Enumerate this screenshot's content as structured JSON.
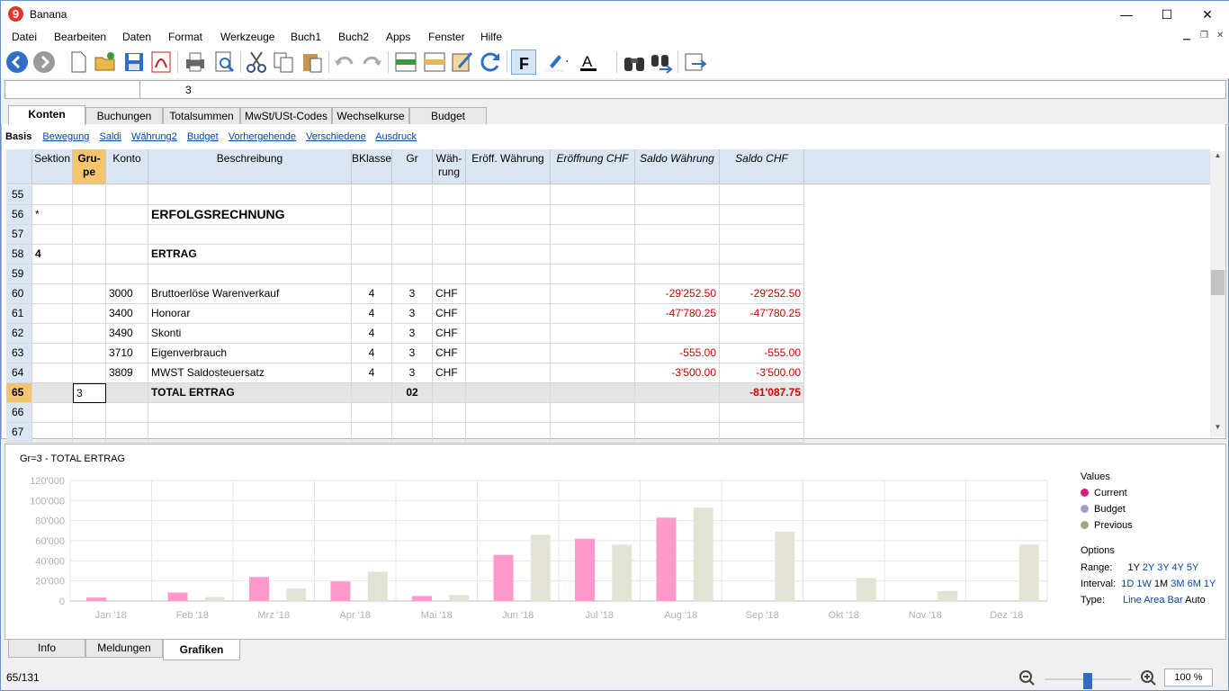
{
  "window": {
    "title": "Banana",
    "minimize": "—",
    "maximize": "☐",
    "close": "✕"
  },
  "menu": [
    "Datei",
    "Bearbeiten",
    "Daten",
    "Format",
    "Werkzeuge",
    "Buch1",
    "Buch2",
    "Apps",
    "Fenster",
    "Hilfe"
  ],
  "formula_bar": {
    "cell_ref": "",
    "value": "3"
  },
  "tabs": [
    "Konten",
    "Buchungen",
    "Totalsummen",
    "MwSt/USt-Codes",
    "Wechselkurse",
    "Budget"
  ],
  "active_tab": "Konten",
  "views": [
    "Basis",
    "Bewegung",
    "Saldi",
    "Währung2",
    "Budget",
    "Vorhergehende",
    "Verschiedene",
    "Ausdruck"
  ],
  "columns": [
    "Sektion",
    "Gru-\npe",
    "Konto",
    "Beschreibung",
    "BKlasse",
    "Gr",
    "Wäh-\nrung",
    "Eröff. Währung",
    "Eröffnung CHF",
    "Saldo Währung",
    "Saldo CHF"
  ],
  "rows": [
    {
      "n": "55",
      "sektion": "",
      "gruppe": "",
      "konto": "",
      "beschr": "",
      "bklasse": "",
      "gr": "",
      "waehrung": "",
      "saldo_w": "",
      "saldo_chf": ""
    },
    {
      "n": "56",
      "sektion": "*",
      "gruppe": "",
      "konto": "",
      "beschr": "ERFOLGSRECHNUNG",
      "bklasse": "",
      "gr": "",
      "waehrung": "",
      "saldo_w": "",
      "saldo_chf": ""
    },
    {
      "n": "57",
      "sektion": "",
      "gruppe": "",
      "konto": "",
      "beschr": "",
      "bklasse": "",
      "gr": "",
      "waehrung": "",
      "saldo_w": "",
      "saldo_chf": ""
    },
    {
      "n": "58",
      "sektion": "4",
      "gruppe": "",
      "konto": "",
      "beschr": "ERTRAG",
      "bklasse": "",
      "gr": "",
      "waehrung": "",
      "saldo_w": "",
      "saldo_chf": ""
    },
    {
      "n": "59",
      "sektion": "",
      "gruppe": "",
      "konto": "",
      "beschr": "",
      "bklasse": "",
      "gr": "",
      "waehrung": "",
      "saldo_w": "",
      "saldo_chf": ""
    },
    {
      "n": "60",
      "sektion": "",
      "gruppe": "",
      "konto": "3000",
      "beschr": "Bruttoerlöse Warenverkauf",
      "bklasse": "4",
      "gr": "3",
      "waehrung": "CHF",
      "saldo_w": "-29'252.50",
      "saldo_chf": "-29'252.50"
    },
    {
      "n": "61",
      "sektion": "",
      "gruppe": "",
      "konto": "3400",
      "beschr": "Honorar",
      "bklasse": "4",
      "gr": "3",
      "waehrung": "CHF",
      "saldo_w": "-47'780.25",
      "saldo_chf": "-47'780.25"
    },
    {
      "n": "62",
      "sektion": "",
      "gruppe": "",
      "konto": "3490",
      "beschr": "Skonti",
      "bklasse": "4",
      "gr": "3",
      "waehrung": "CHF",
      "saldo_w": "",
      "saldo_chf": ""
    },
    {
      "n": "63",
      "sektion": "",
      "gruppe": "",
      "konto": "3710",
      "beschr": "Eigenverbrauch",
      "bklasse": "4",
      "gr": "3",
      "waehrung": "CHF",
      "saldo_w": "-555.00",
      "saldo_chf": "-555.00"
    },
    {
      "n": "64",
      "sektion": "",
      "gruppe": "",
      "konto": "3809",
      "beschr": "MWST Saldosteuersatz",
      "bklasse": "4",
      "gr": "3",
      "waehrung": "CHF",
      "saldo_w": "-3'500.00",
      "saldo_chf": "-3'500.00"
    },
    {
      "n": "65",
      "sektion": "",
      "gruppe": "3",
      "konto": "",
      "beschr": "TOTAL ERTRAG",
      "bklasse": "",
      "gr": "02",
      "waehrung": "",
      "saldo_w": "",
      "saldo_chf": "-81'087.75"
    },
    {
      "n": "66",
      "sektion": "",
      "gruppe": "",
      "konto": "",
      "beschr": "",
      "bklasse": "",
      "gr": "",
      "waehrung": "",
      "saldo_w": "",
      "saldo_chf": ""
    },
    {
      "n": "67",
      "sektion": "",
      "gruppe": "",
      "konto": "",
      "beschr": "",
      "bklasse": "",
      "gr": "",
      "waehrung": "",
      "saldo_w": "",
      "saldo_chf": ""
    }
  ],
  "chart_data": {
    "type": "bar",
    "title": "Gr=3 - TOTAL ERTRAG",
    "categories": [
      "Jan '18",
      "Feb '18",
      "Mrz '18",
      "Apr '18",
      "Mai '18",
      "Jun '18",
      "Jul '18",
      "Aug '18",
      "Sep '18",
      "Okt '18",
      "Nov '18",
      "Dez '18"
    ],
    "ylim": [
      0,
      120000
    ],
    "yticks": [
      "0",
      "20'000",
      "40'000",
      "60'000",
      "80'000",
      "100'000",
      "120'000"
    ],
    "grid": true,
    "legend_position": "right",
    "series": [
      {
        "name": "Current",
        "color": "#ff99cc",
        "values": [
          3500,
          8500,
          24000,
          19500,
          5000,
          46000,
          62000,
          83000,
          0,
          0,
          0,
          0
        ]
      },
      {
        "name": "Previous",
        "color": "#e3e3d4",
        "values": [
          0,
          4000,
          12500,
          29000,
          6000,
          66000,
          56000,
          93000,
          69000,
          23000,
          10000,
          56000
        ]
      }
    ]
  },
  "legend": {
    "title": "Values",
    "items": [
      {
        "label": "Current",
        "color": "#e0187d"
      },
      {
        "label": "Budget",
        "color": "#a09ed0"
      },
      {
        "label": "Previous",
        "color": "#a5a57a"
      }
    ]
  },
  "options": {
    "title": "Options",
    "range_label": "Range:",
    "range": [
      "1Y",
      "2Y",
      "3Y",
      "4Y",
      "5Y"
    ],
    "interval_label": "Interval:",
    "interval": [
      "1D",
      "1W",
      "1M",
      "3M",
      "6M",
      "1Y"
    ],
    "type_label": "Type:",
    "types": [
      "Line",
      "Area",
      "Bar",
      "Auto"
    ]
  },
  "bottom_tabs": [
    "Info",
    "Meldungen",
    "Grafiken"
  ],
  "status": {
    "position": "65/131",
    "zoom": "100 %"
  }
}
